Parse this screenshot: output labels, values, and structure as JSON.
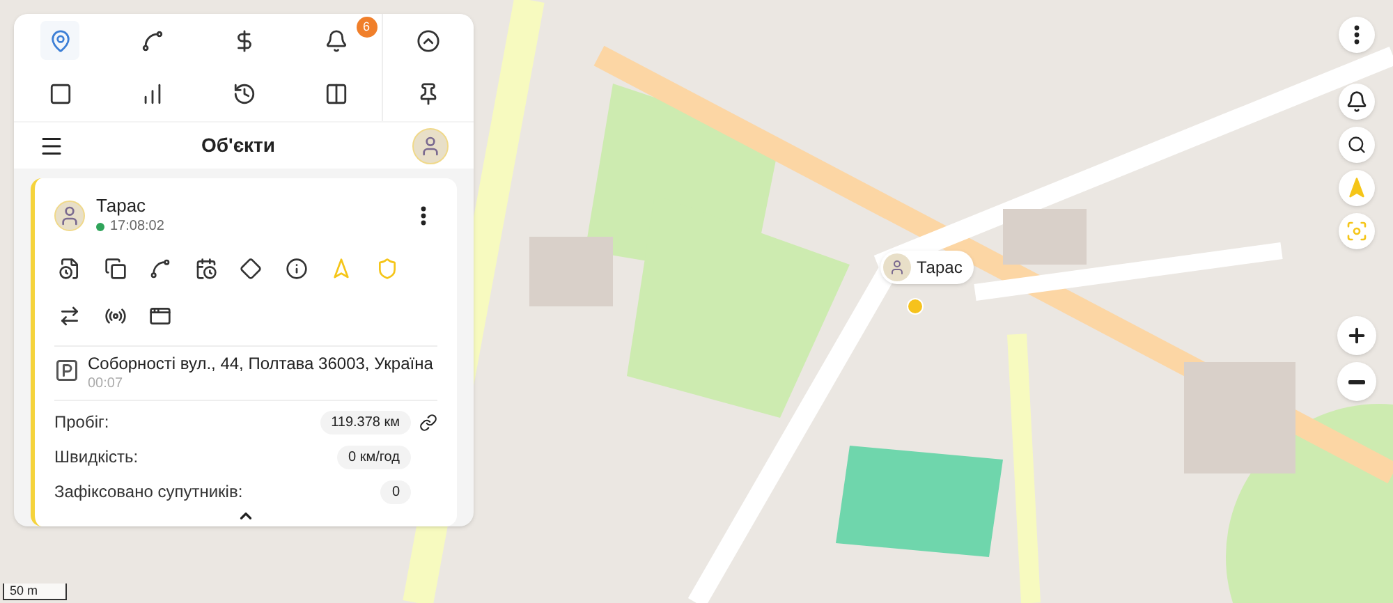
{
  "toolbar": {
    "items": [
      {
        "selected": true
      },
      {
        "selected": false
      },
      {
        "selected": false
      },
      {
        "selected": false,
        "badge": "6"
      },
      {
        "selected": false
      },
      {
        "selected": false
      },
      {
        "selected": false
      },
      {
        "selected": false
      },
      {
        "selected": false
      },
      {
        "selected": false
      }
    ]
  },
  "header": {
    "title": "Об'єкти"
  },
  "object": {
    "name": "Тарас",
    "online": true,
    "time": "17:08:02",
    "actions": [
      {
        "active": false
      },
      {
        "active": false
      },
      {
        "active": false
      },
      {
        "active": false
      },
      {
        "active": false
      },
      {
        "active": false
      },
      {
        "active": true
      },
      {
        "active": true
      },
      {
        "active": false
      },
      {
        "active": false
      },
      {
        "active": false
      }
    ],
    "address": "Соборності вул., 44, Полтава 36003, Україна",
    "duration": "00:07",
    "stats": [
      {
        "label": "Пробіг:",
        "value": "119.378 км",
        "kind": "link"
      },
      {
        "label": "Швидкість:",
        "value": "0 км/год",
        "kind": "plain"
      },
      {
        "label": "Зафіксовано супутників:",
        "value": "0",
        "kind": "plain"
      }
    ]
  },
  "map": {
    "marker_label": "Тарас",
    "scale": "50 m"
  }
}
